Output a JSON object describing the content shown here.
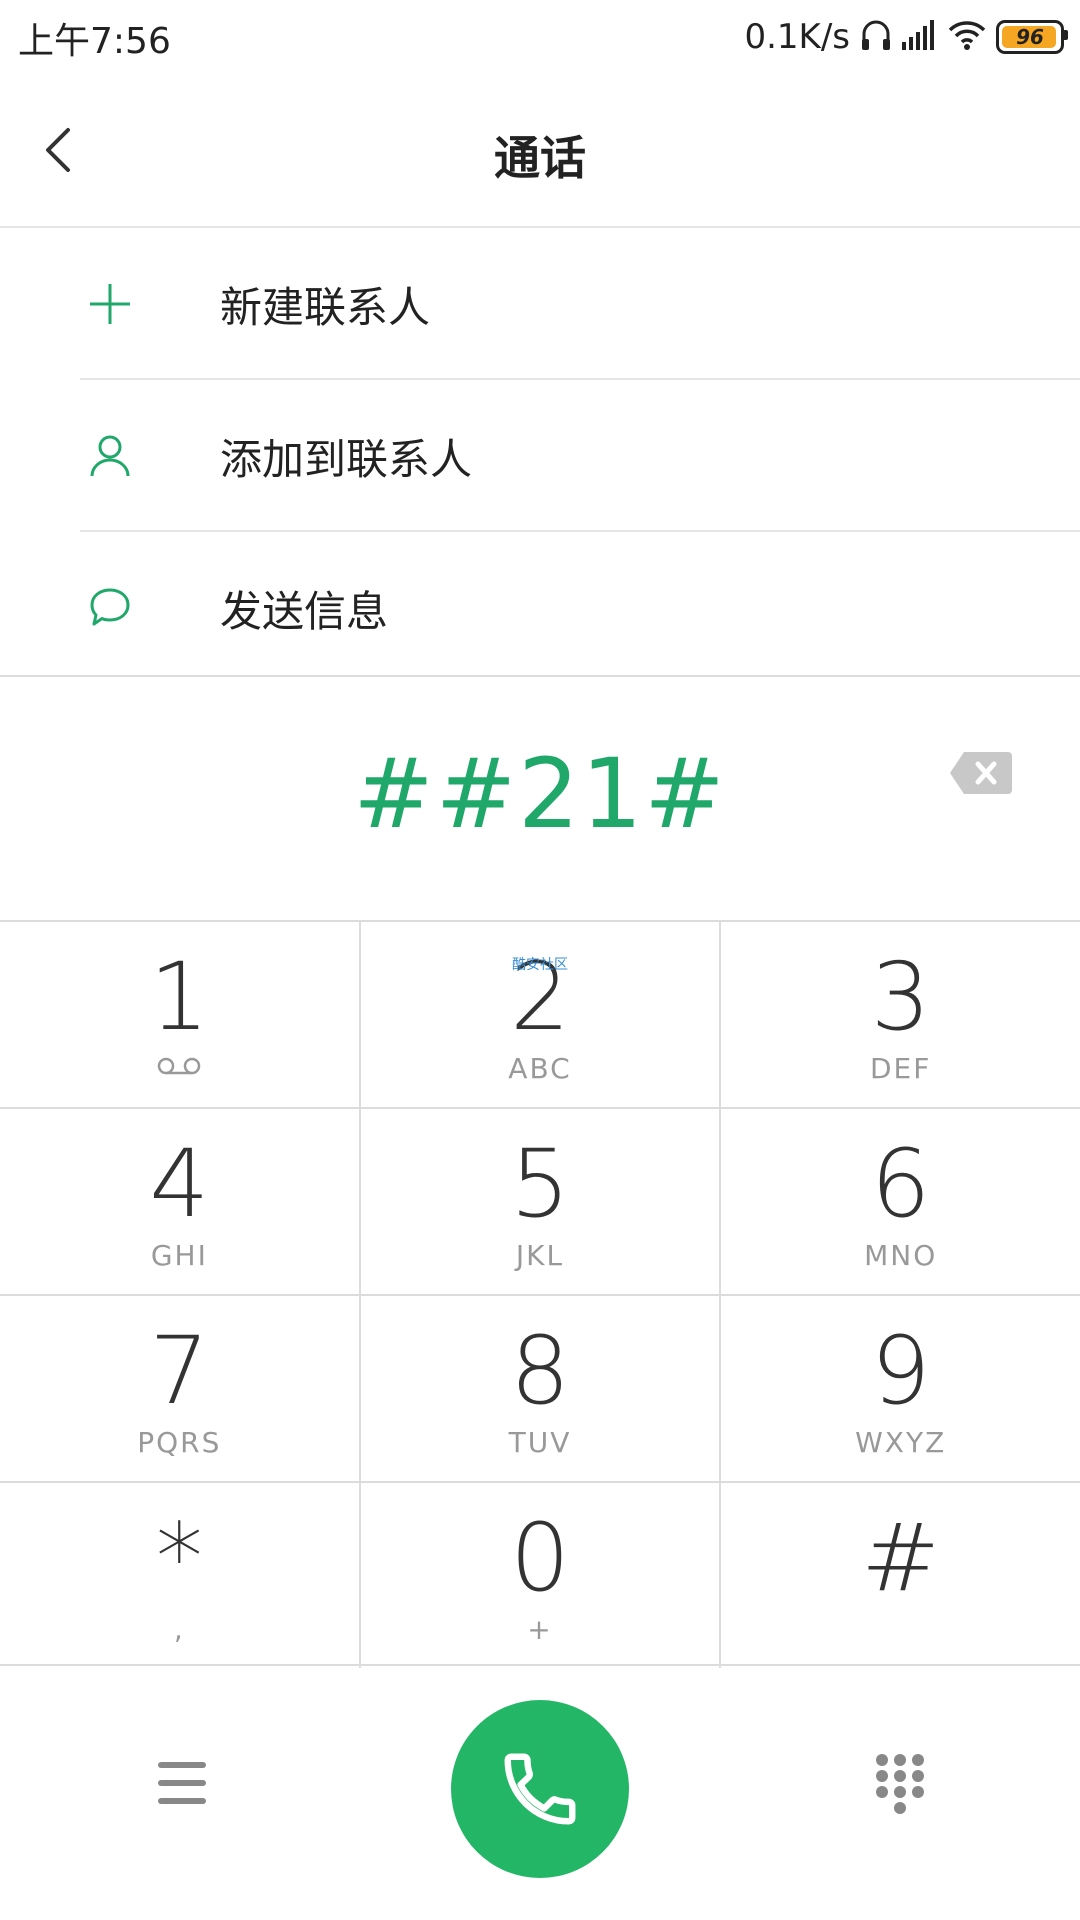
{
  "status_bar": {
    "time": "上午7:56",
    "network_speed": "0.1K/s",
    "battery": "96",
    "battery_color": "#f5a623"
  },
  "header": {
    "title": "通话"
  },
  "actions": [
    {
      "label": "新建联系人",
      "icon": "plus-icon"
    },
    {
      "label": "添加到联系人",
      "icon": "person-icon"
    },
    {
      "label": "发送信息",
      "icon": "message-bubble-icon"
    }
  ],
  "dialed_number": "##21#",
  "keypad": {
    "keys": [
      {
        "digit": "1",
        "letters": ""
      },
      {
        "digit": "2",
        "letters": "ABC"
      },
      {
        "digit": "3",
        "letters": "DEF"
      },
      {
        "digit": "4",
        "letters": "GHI"
      },
      {
        "digit": "5",
        "letters": "JKL"
      },
      {
        "digit": "6",
        "letters": "MNO"
      },
      {
        "digit": "7",
        "letters": "PQRS"
      },
      {
        "digit": "8",
        "letters": "TUV"
      },
      {
        "digit": "9",
        "letters": "WXYZ"
      },
      {
        "digit": "*",
        "letters": ","
      },
      {
        "digit": "0",
        "letters": "+"
      },
      {
        "digit": "#",
        "letters": ""
      }
    ],
    "watermark": "酷安社区"
  },
  "colors": {
    "accent": "#1fa86a",
    "call_button": "#23b666"
  }
}
